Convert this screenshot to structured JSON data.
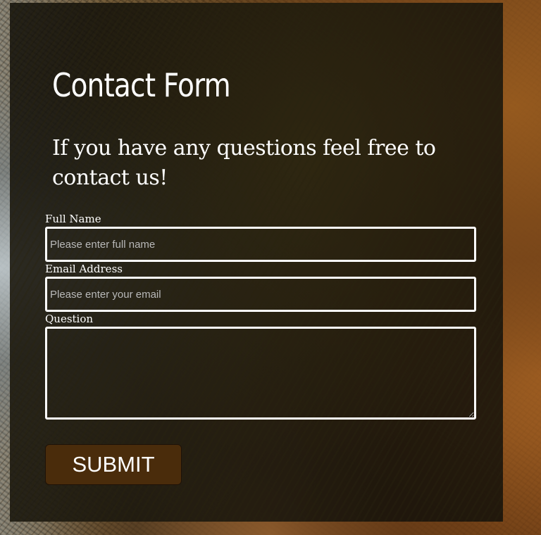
{
  "form": {
    "title": "Contact Form",
    "subtitle": "If you have any questions feel free to contact us!",
    "fields": {
      "full_name": {
        "label": "Full Name",
        "placeholder": "Please enter full name",
        "value": ""
      },
      "email": {
        "label": "Email Address",
        "placeholder": "Please enter your email",
        "value": ""
      },
      "question": {
        "label": "Question",
        "placeholder": "",
        "value": ""
      }
    },
    "submit_label": "SUBMIT"
  },
  "colors": {
    "submit_background": "#4a2c0b",
    "text": "#ffffff",
    "field_border": "#ffffff"
  }
}
